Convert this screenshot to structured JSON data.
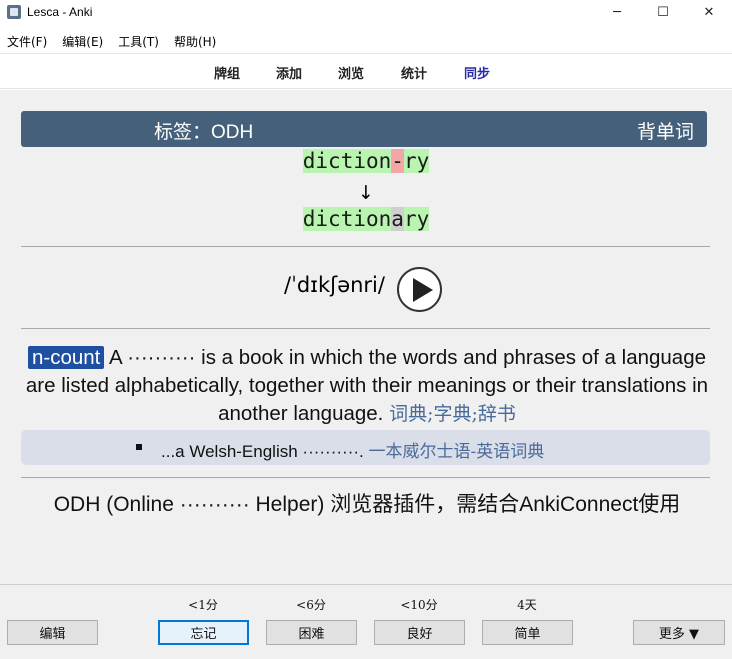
{
  "window": {
    "title": "Lesca - Anki",
    "minimize": "─",
    "maximize": "☐",
    "close": "✕"
  },
  "menu": [
    "文件(F)",
    "编辑(E)",
    "工具(T)",
    "帮助(H)"
  ],
  "toolbar": {
    "decks": "牌组",
    "add": "添加",
    "browse": "浏览",
    "stats": "统计",
    "sync": "同步"
  },
  "card": {
    "tag_label": "标签：ODH",
    "deck_name": "背单词",
    "typed_answer": {
      "part1": "diction",
      "missing": "-",
      "part2": "ry"
    },
    "arrow": "↓",
    "correct_answer": {
      "part1": "diction",
      "diff": "a",
      "part2": "ry"
    },
    "phonetic": "/ˈdɪkʃənri/",
    "definition": {
      "pos": "n-count",
      "text": "A ·········· is a book in which the words and phrases of a language are listed alphabetically, together with their meanings or their translations in another language.",
      "chinese": "词典;字典;辞书"
    },
    "example": {
      "text": "...a Welsh-English ··········.",
      "chinese": "一本威尔士语-英语词典"
    },
    "note": "ODH (Online ·········· Helper) 浏览器插件，需结合AnkiConnect使用"
  },
  "bottom": {
    "edit": "编辑",
    "more": "更多 ▼",
    "answers": [
      {
        "interval": "<1分",
        "label": "忘记"
      },
      {
        "interval": "<6分",
        "label": "困难"
      },
      {
        "interval": "<10分",
        "label": "良好"
      },
      {
        "interval": "4天",
        "label": "简单"
      }
    ]
  },
  "colors": {
    "banner": "#44607a",
    "correct_highlight": "#b9f5b1",
    "wrong_highlight": "#f3a6a6",
    "pos_badge": "#1f4fa0",
    "chinese_text": "#4a6a9a",
    "sync_link": "#2a2aa6"
  }
}
